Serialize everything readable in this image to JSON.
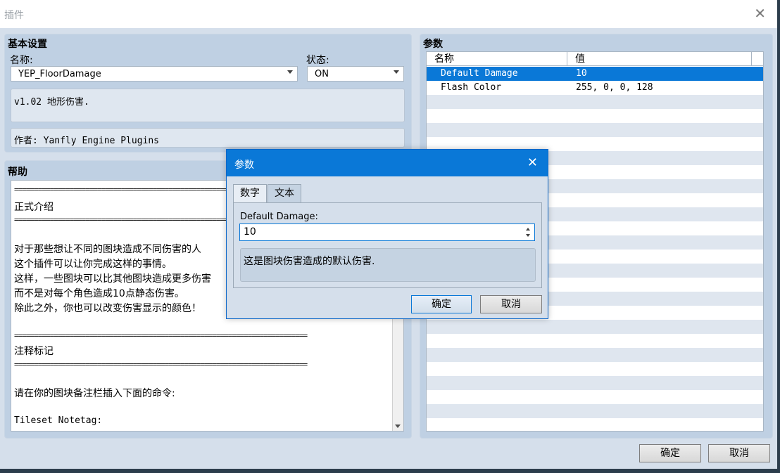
{
  "window": {
    "title": "插件",
    "close_glyph": "✕"
  },
  "basic": {
    "heading": "基本设置",
    "name_label": "名称:",
    "name_value": "YEP_FloorDamage",
    "status_label": "状态:",
    "status_value": "ON",
    "description": "v1.02 地形伤害.",
    "author": "作者: Yanfly Engine Plugins"
  },
  "help": {
    "heading": "帮助",
    "lines": [
      "==========================================================================",
      "正式介绍",
      "==========================================================================",
      "",
      "对于那些想让不同的图块造成不同伤害的人",
      "这个插件可以让你完成这样的事情。",
      "这样，一些图块可以比其他图块造成更多伤害",
      "而不是对每个角色造成10点静态伤害。",
      "除此之外，你也可以改变伤害显示的颜色！",
      "",
      "==========================================================================",
      "注释标记",
      "==========================================================================",
      "",
      "请在你的图块备注栏插入下面的命令:",
      "",
      "Tileset Notetag:"
    ]
  },
  "params": {
    "heading": "参数",
    "col_name": "名称",
    "col_value": "值",
    "rows": [
      {
        "name": "Default Damage",
        "value": "10"
      },
      {
        "name": "Flash Color",
        "value": "255, 0, 0, 128"
      }
    ]
  },
  "footer": {
    "ok": "确定",
    "cancel": "取消"
  },
  "dialog": {
    "title": "参数",
    "close_glyph": "✕",
    "tab_number": "数字",
    "tab_text": "文本",
    "field_label": "Default Damage:",
    "field_value": "10",
    "description": "这是图块伤害造成的默认伤害.",
    "ok": "确定",
    "cancel": "取消"
  },
  "colors": {
    "accent": "#0a78d7",
    "selected_row": "#0a78d7",
    "panel": "#bfd0e3"
  }
}
